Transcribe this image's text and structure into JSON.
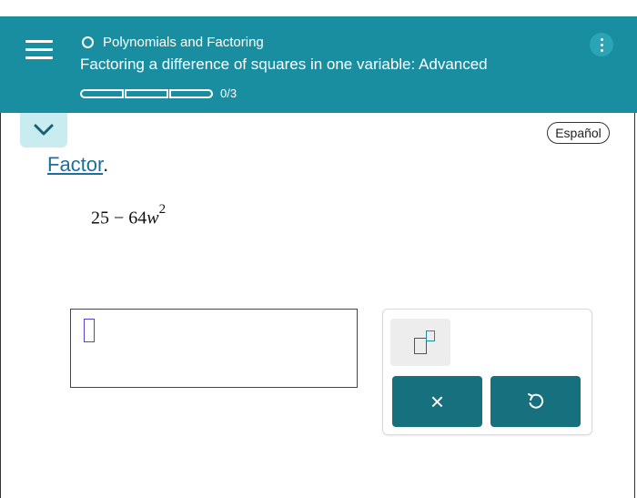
{
  "header": {
    "topic": "Polynomials and Factoring",
    "title": "Factoring a difference of squares in one variable: Advanced",
    "progress": {
      "text": "0/3",
      "completed": 0,
      "total": 3
    }
  },
  "language_button": "Español",
  "instruction": {
    "link_text": "Factor",
    "punctuation": "."
  },
  "expression": {
    "constant": "25",
    "minus": "−",
    "coefficient": "64",
    "variable": "w",
    "exponent": "2"
  },
  "tools": {
    "clear_symbol": "×"
  },
  "colors": {
    "header_bg": "#1a8ea1",
    "button_bg": "#17707d",
    "collapse_tab": "#c8ecef",
    "link": "#1a6fa0",
    "cursor": "#5a3fd1"
  }
}
